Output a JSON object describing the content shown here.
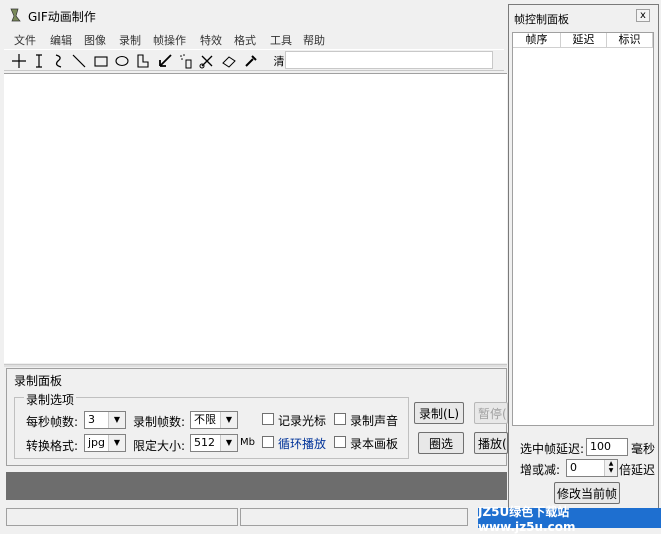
{
  "app": {
    "title": "GIF动画制作"
  },
  "menu": [
    "文件",
    "编辑",
    "图像",
    "录制",
    "帧操作",
    "特效",
    "格式",
    "工具",
    "帮助"
  ],
  "toolbar": {
    "clear_label": "清"
  },
  "record_panel": {
    "title": "录制面板",
    "options_legend": "录制选项",
    "fps_label": "每秒帧数:",
    "fps_value": "3",
    "frames_label": "录制帧数:",
    "frames_value": "不限",
    "format_label": "转换格式:",
    "format_value": "jpg",
    "size_label": "限定大小:",
    "size_value": "512",
    "size_unit": "Mb",
    "cursor_label": "记录光标",
    "sound_label": "录制声音",
    "loop_label": "循环播放",
    "canvas_label": "录本画板",
    "record_btn": "录制(L)",
    "pause_btn": "暂停(",
    "area_btn": "圈选",
    "play_btn": "播放("
  },
  "frame_panel": {
    "title": "帧控制面板",
    "close": "x",
    "columns": [
      "帧序",
      "延迟",
      "标识"
    ],
    "selected_delay_label": "选中帧延迟:",
    "selected_delay_value": "100",
    "delay_unit": "毫秒",
    "adjust_label": "增或减:",
    "adjust_value": "0",
    "adjust_unit": "倍延迟",
    "modify_btn": "修改当前帧"
  },
  "watermark": "JZ5U绿色下载站www.jz5u.com",
  "colors": {
    "loop_text": "#003399",
    "watermark_bg": "#1e6fd0"
  }
}
